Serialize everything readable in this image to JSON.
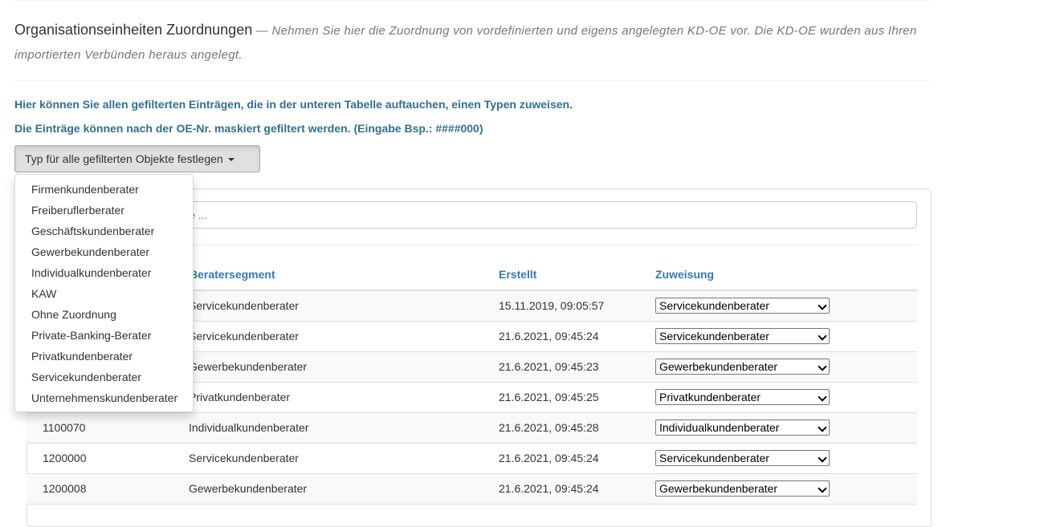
{
  "header": {
    "title": "Organisationseinheiten Zuordnungen",
    "subtitle": "— Nehmen Sie hier die Zuordnung von vordefinierten und eigens angelegten KD-OE vor. Die KD-OE wurden aus Ihren importierten Verbünden heraus angelegt."
  },
  "info": {
    "line1": "Hier können Sie allen gefilterten Einträgen, die in der unteren Tabelle auftauchen, einen Typen zuweisen.",
    "line2": "Die Einträge können nach der OE-Nr. maskiert gefiltert werden. (Eingabe Bsp.: ####000)"
  },
  "dropdown": {
    "button_label": "Typ für alle gefilterten Objekte festlegen",
    "items": [
      "Firmenkundenberater",
      "Freiberuflerberater",
      "Geschäftskundenberater",
      "Gewerbekundenberater",
      "Individualkundenberater",
      "KAW",
      "Ohne Zuordnung",
      "Private-Banking-Berater",
      "Privatkundenberater",
      "Servicekundenberater",
      "Unternehmenskundenberater"
    ]
  },
  "filter": {
    "placeholder": "Bsp.: ####030), Filter via Name ..."
  },
  "table": {
    "headers": {
      "segment": "Beratersegment",
      "created": "Erstellt",
      "assignment": "Zuweisung"
    },
    "rows": [
      {
        "oe": "",
        "segment": "Servicekundenberater",
        "created": "15.11.2019, 09:05:57",
        "assignment": "Servicekundenberater"
      },
      {
        "oe": "",
        "segment": "Servicekundenberater",
        "created": "21.6.2021, 09:45:24",
        "assignment": "Servicekundenberater"
      },
      {
        "oe": "",
        "segment": "Gewerbekundenberater",
        "created": "21.6.2021, 09:45:23",
        "assignment": "Gewerbekundenberater"
      },
      {
        "oe": "",
        "segment": "Privatkundenberater",
        "created": "21.6.2021, 09:45:25",
        "assignment": "Privatkundenberater"
      },
      {
        "oe": "1100070",
        "segment": "Individualkundenberater",
        "created": "21.6.2021, 09:45:28",
        "assignment": "Individualkundenberater"
      },
      {
        "oe": "1200000",
        "segment": "Servicekundenberater",
        "created": "21.6.2021, 09:45:24",
        "assignment": "Servicekundenberater"
      },
      {
        "oe": "1200008",
        "segment": "Gewerbekundenberater",
        "created": "21.6.2021, 09:45:24",
        "assignment": "Gewerbekundenberater"
      }
    ]
  }
}
